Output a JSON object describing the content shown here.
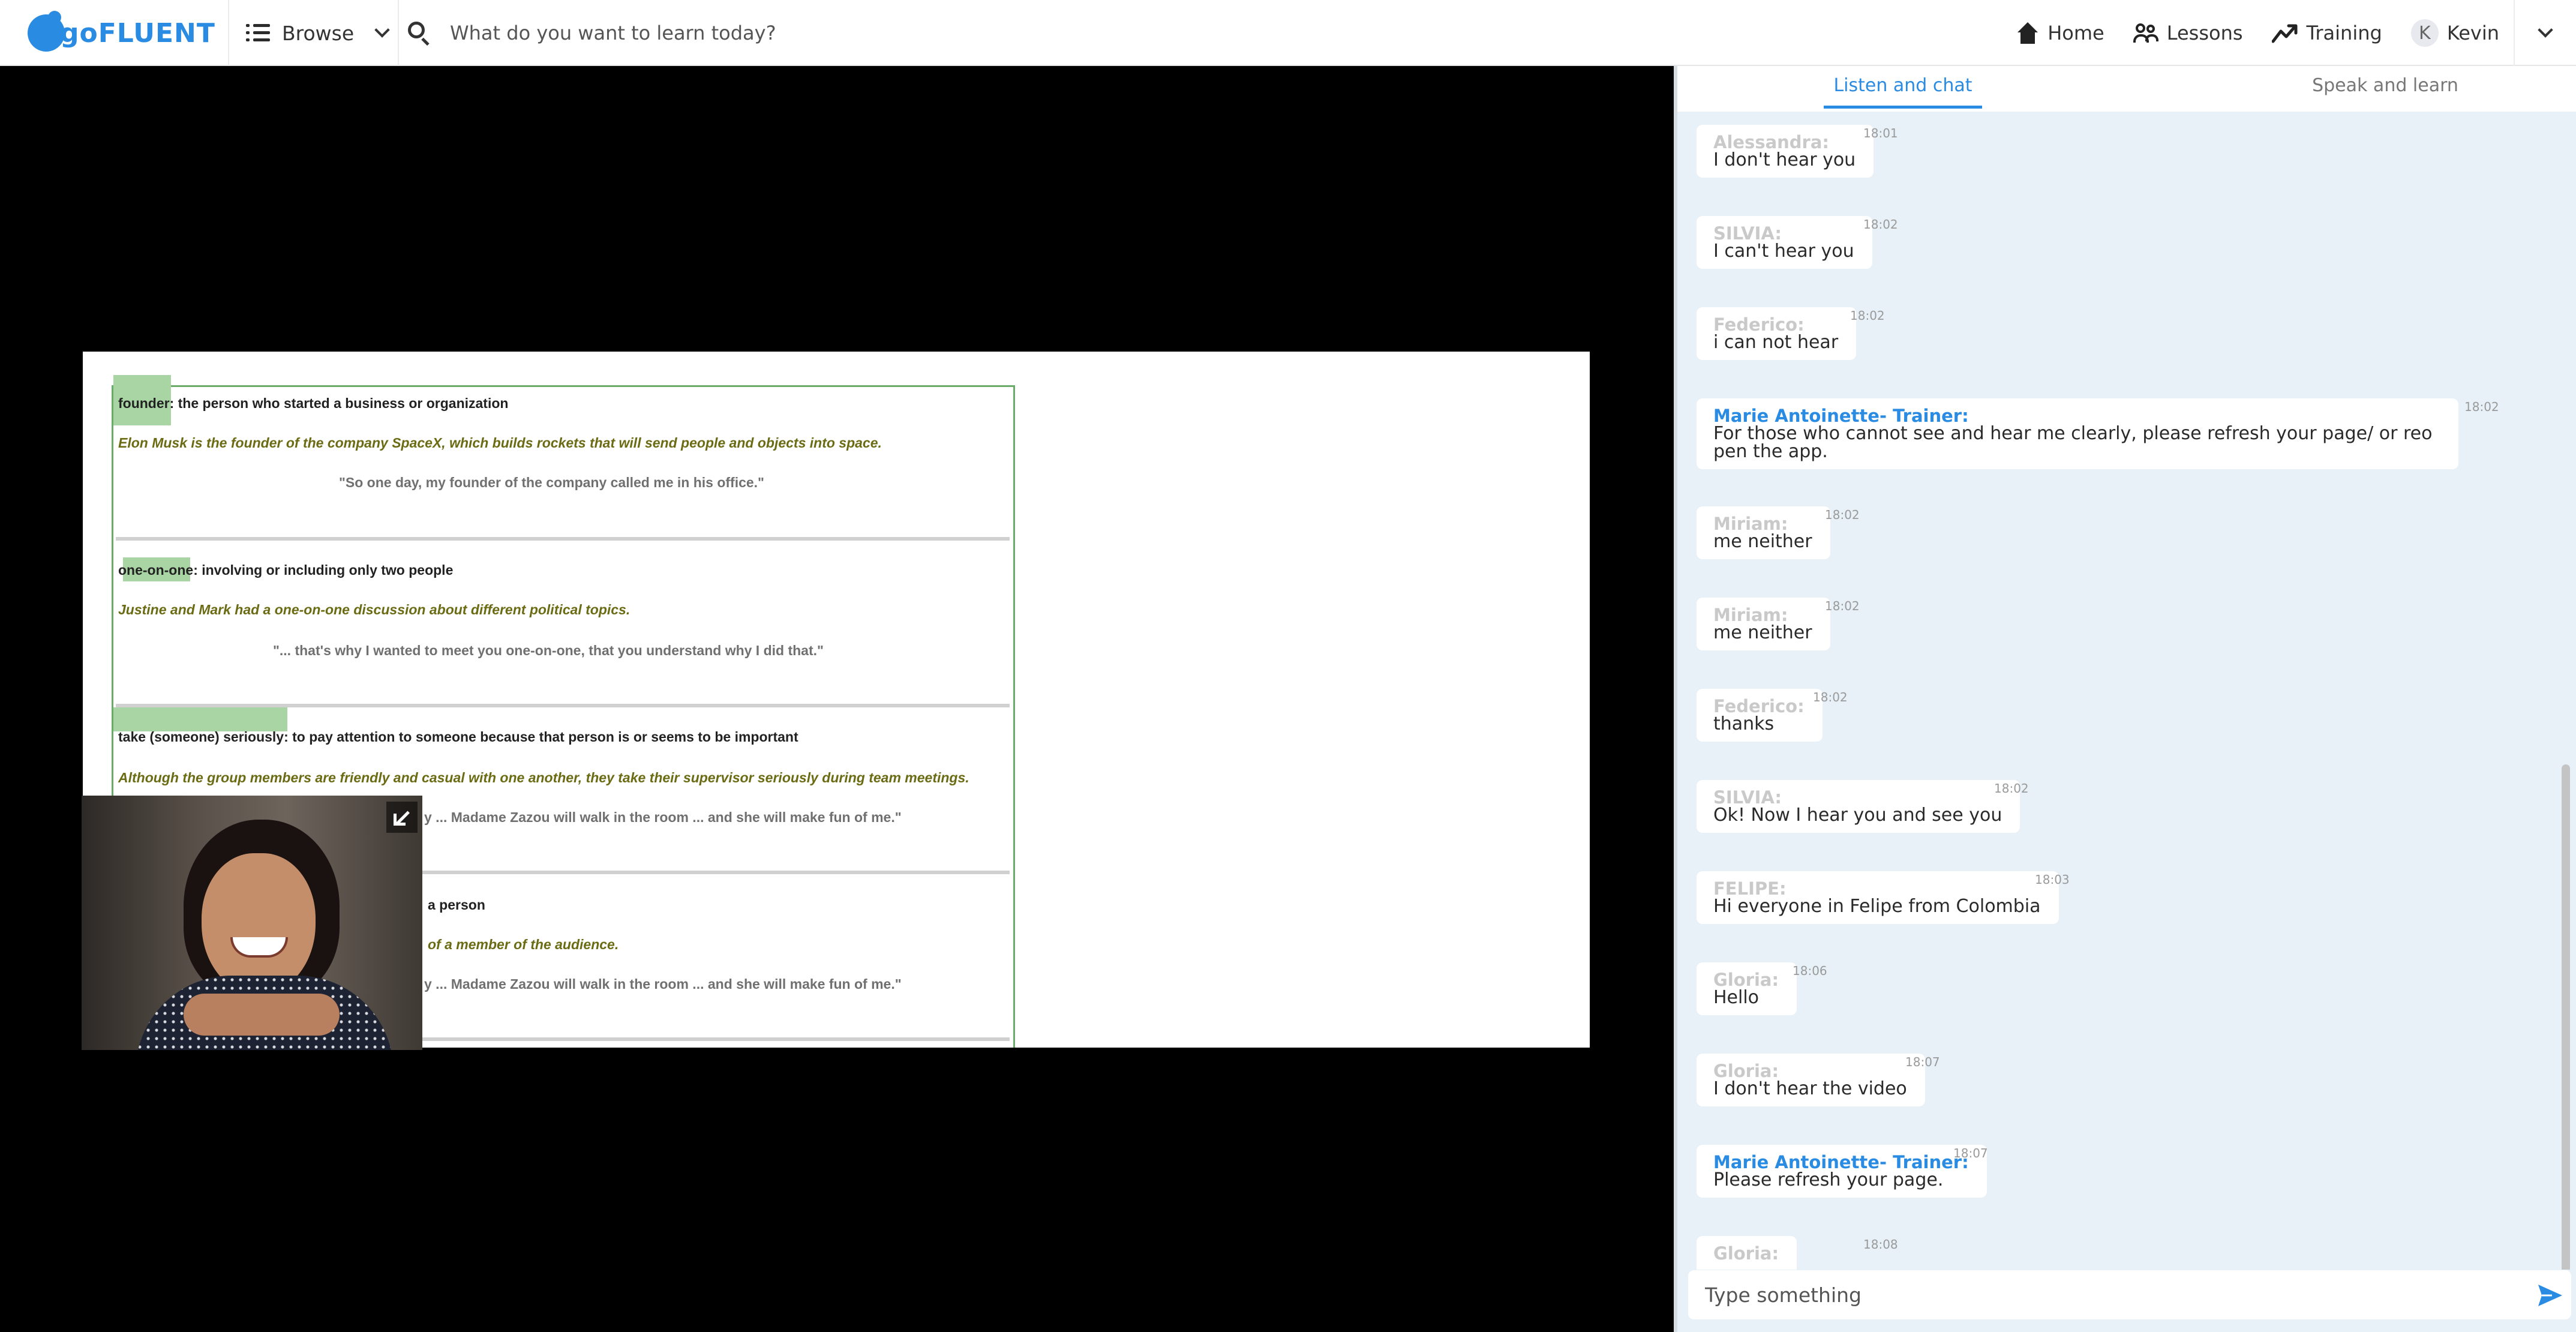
{
  "header": {
    "logo_text": "goFLUENT",
    "browse_label": "Browse",
    "search_placeholder": "What do you want to learn today?",
    "nav": {
      "home": "Home",
      "lessons": "Lessons",
      "training": "Training",
      "user_initial": "K",
      "user_name": "Kevin"
    }
  },
  "slide": {
    "entries": [
      {
        "term": "founder: the person who started a business or organization",
        "example": "Elon Musk is the founder of the company SpaceX, which builds rockets that will send people and objects into space.",
        "quote": "\"So one day, my founder of the company called me in his office.\""
      },
      {
        "term": "one-on-one: involving or including only two people",
        "example": "Justine and Mark had a one-on-one discussion about different political topics.",
        "quote": "\"... that's why I wanted to meet you one-on-one, that you understand why I did that.\""
      },
      {
        "term": "take (someone) seriously: to pay attention to someone because that person is or seems to be important",
        "example": "Although the group members are friendly and casual with one another, they take their supervisor seriously during team meetings.",
        "quote": "y ... Madame Zazou will walk in the room ... and she will make fun of me.\""
      },
      {
        "term": "a person",
        "example": "of a member of the audience.",
        "quote": "y ... Madame Zazou will walk in the room ... and she will make fun of me.\""
      }
    ]
  },
  "chat": {
    "tabs": [
      "Listen and chat",
      "Speak and learn"
    ],
    "messages": [
      {
        "sender": "Alessandra:",
        "text": "I don't hear you",
        "time": "18:01",
        "trainer": false
      },
      {
        "sender": "SILVIA:",
        "text": "I can't hear you",
        "time": "18:02",
        "trainer": false
      },
      {
        "sender": "Federico:",
        "text": "i can not hear",
        "time": "18:02",
        "trainer": false
      },
      {
        "sender": "Marie Antoinette- Trainer:",
        "text": "For those who cannot see and hear me clearly, please refresh your page/ or reopen the app.",
        "time": "18:02",
        "trainer": true
      },
      {
        "sender": "Miriam:",
        "text": "me neither",
        "time": "18:02",
        "trainer": false
      },
      {
        "sender": "Miriam:",
        "text": "me neither",
        "time": "18:02",
        "trainer": false
      },
      {
        "sender": "Federico:",
        "text": "thanks",
        "time": "18:02",
        "trainer": false
      },
      {
        "sender": "SILVIA:",
        "text": "Ok! Now I hear you and see you",
        "time": "18:02",
        "trainer": false
      },
      {
        "sender": "FELIPE:",
        "text": "Hi everyone in Felipe from Colombia",
        "time": "18:03",
        "trainer": false
      },
      {
        "sender": "Gloria:",
        "text": "Hello",
        "time": "18:06",
        "trainer": false
      },
      {
        "sender": "Gloria:",
        "text": "I don't hear the video",
        "time": "18:07",
        "trainer": false
      },
      {
        "sender": "Marie Antoinette- Trainer:",
        "text": "Please refresh your page.",
        "time": "18:07",
        "trainer": true
      },
      {
        "sender": "Gloria:",
        "text": "",
        "time": "18:08",
        "trainer": false
      }
    ],
    "input_placeholder": "Type something"
  },
  "colors": {
    "brand": "#2a8be3",
    "highlight": "#a9d5a4",
    "example_text": "#6b6b14",
    "chat_bg": "#e7f1f7"
  },
  "icons": [
    "list-icon",
    "chevron-down-icon",
    "search-icon",
    "home-icon",
    "lessons-icon",
    "training-icon",
    "collapse-arrow-icon",
    "send-icon"
  ]
}
